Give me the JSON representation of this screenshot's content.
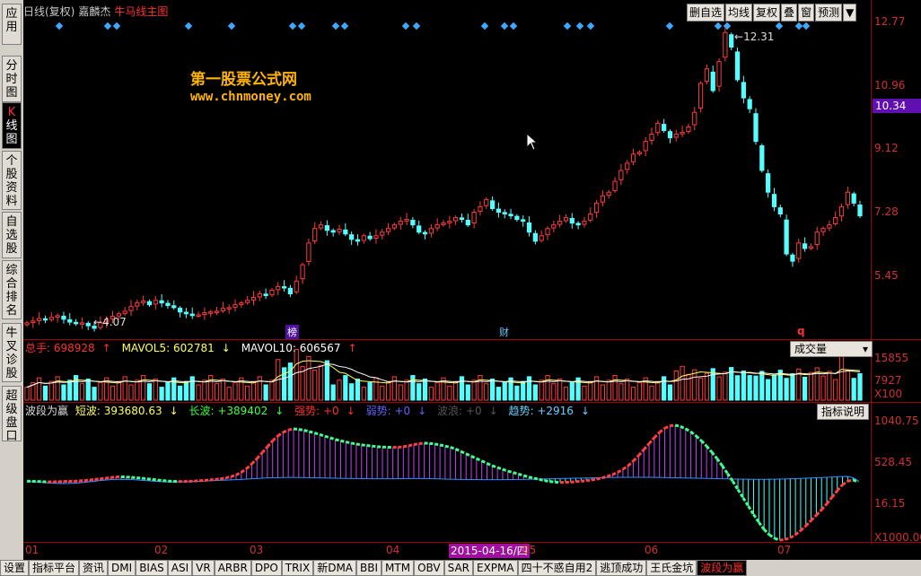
{
  "left_tabs": [
    {
      "label": "应用",
      "top": 4,
      "height": 46
    },
    {
      "label": "分时图",
      "top": 62,
      "height": 52
    },
    {
      "label": "K线图",
      "top": 114,
      "height": 52,
      "active": true
    },
    {
      "label": "个股资料",
      "top": 168,
      "height": 66
    },
    {
      "label": "自选股",
      "top": 236,
      "height": 52
    },
    {
      "label": "综合排名",
      "top": 290,
      "height": 66
    },
    {
      "label": "牛叉诊股",
      "top": 360,
      "height": 66
    },
    {
      "label": "超级盘口",
      "top": 430,
      "height": 62
    }
  ],
  "header": {
    "period": "日线(复权)",
    "stock": "嘉麟杰",
    "template": "牛马线主图"
  },
  "toolbar": [
    "删自选",
    "均线",
    "复权",
    "叠",
    "窗",
    "预测",
    "▼"
  ],
  "watermark": {
    "line1": "第一股票公式网",
    "line2": "www.chnmoney.com"
  },
  "price_axis": {
    "labels": [
      "12.77",
      "10.96",
      "9.12",
      "7.28",
      "5.45"
    ],
    "current": "10.34"
  },
  "annotations": {
    "high": "12.31",
    "low": "4.07",
    "m1": "榜",
    "m2": "财",
    "m3": "q"
  },
  "volume_pane": {
    "total": "总手: 698928",
    "mavol5": "MAVOL5: 602781",
    "mavol10": "MAVOL10: 606567",
    "dropdown": "成交量",
    "axis": [
      "15855",
      "7927",
      "X100"
    ]
  },
  "indicator_pane": {
    "name": "波段为赢",
    "short": "短波: 393680.63",
    "long": "长波: +389402",
    "strong": "强势: +0",
    "weak": "弱势: +0",
    "wave": "波浪: +0",
    "trend": "趋势: +2916",
    "button": "指标说明",
    "axis": [
      "1040.75",
      "528.45",
      "16.15",
      "X1000.00"
    ]
  },
  "dates": {
    "labels": [
      "01",
      "02",
      "03",
      "04",
      "05",
      "06",
      "07"
    ],
    "selected": "2015-04-16/四"
  },
  "bottom_tabs": [
    "设置",
    "指标平台",
    "资讯",
    "DMI",
    "BIAS",
    "ASI",
    "VR",
    "ARBR",
    "DPO",
    "TRIX",
    "新DMA",
    "BBI",
    "MTM",
    "OBV",
    "SAR",
    "EXPMA",
    "四十不惑自用2",
    "逃顶成功",
    "王氏金坑",
    "波段为赢"
  ],
  "colors": {
    "up": "#ff3b3b",
    "down": "#54ffff",
    "axis": "#a00000",
    "diamond": "#3ca8ff"
  },
  "chart_data": {
    "type": "candlestick",
    "title": "嘉麟杰",
    "ylim": [
      4.0,
      12.9
    ],
    "highest": 12.31,
    "lowest": 4.07,
    "closes": [
      4.3,
      4.35,
      4.42,
      4.38,
      4.45,
      4.5,
      4.4,
      4.32,
      4.28,
      4.3,
      4.22,
      4.15,
      4.3,
      4.4,
      4.48,
      4.55,
      4.62,
      4.75,
      4.85,
      4.9,
      4.8,
      4.92,
      4.85,
      4.78,
      4.72,
      4.6,
      4.55,
      4.5,
      4.52,
      4.58,
      4.6,
      4.62,
      4.7,
      4.72,
      4.8,
      4.85,
      4.92,
      5.0,
      5.1,
      5.05,
      5.2,
      5.3,
      5.28,
      5.1,
      5.45,
      5.9,
      6.5,
      6.9,
      7.0,
      6.85,
      6.8,
      6.88,
      6.75,
      6.6,
      6.55,
      6.7,
      6.62,
      6.7,
      6.8,
      6.9,
      7.0,
      7.1,
      7.15,
      7.0,
      6.8,
      6.75,
      6.9,
      7.0,
      7.05,
      7.1,
      7.2,
      7.15,
      7.0,
      7.35,
      7.5,
      7.7,
      7.45,
      7.35,
      7.3,
      7.25,
      7.15,
      7.1,
      6.8,
      6.55,
      6.7,
      6.9,
      7.0,
      7.1,
      7.2,
      7.05,
      7.0,
      7.1,
      7.3,
      7.6,
      7.8,
      7.9,
      8.2,
      8.5,
      8.7,
      8.95,
      9.0,
      9.3,
      9.5,
      9.8,
      9.6,
      9.4,
      9.5,
      9.55,
      9.7,
      10.1,
      10.9,
      11.3,
      10.7,
      11.5,
      12.3,
      11.9,
      11.0,
      10.5,
      10.2,
      9.3,
      8.5,
      7.9,
      7.5,
      7.3,
      6.2,
      6.0,
      6.5,
      6.35,
      6.4,
      6.8,
      6.9,
      7.0,
      7.2,
      7.5,
      7.9,
      7.6,
      7.25
    ],
    "volume": {
      "ylim": [
        0,
        17500
      ],
      "mavol5": 602781,
      "mavol10": 606567,
      "last": 698928
    },
    "indicator": {
      "ylim": [
        -900,
        1150
      ],
      "short": [
        120,
        118,
        115,
        112,
        110,
        110,
        112,
        115,
        118,
        120,
        125,
        130,
        140,
        150,
        160,
        170,
        180,
        190,
        195,
        190,
        185,
        178,
        170,
        160,
        150,
        140,
        130,
        122,
        118,
        115,
        115,
        118,
        122,
        128,
        135,
        142,
        150,
        160,
        175,
        195,
        225,
        270,
        330,
        410,
        500,
        600,
        700,
        800,
        880,
        940,
        980,
        1000,
        990,
        975,
        955,
        930,
        905,
        875,
        850,
        820,
        800,
        780,
        760,
        745,
        730,
        720,
        710,
        700,
        695,
        690,
        688,
        690,
        700,
        715,
        735,
        750,
        760,
        755,
        745,
        730,
        710,
        690,
        660,
        620,
        580,
        540,
        500,
        460,
        420,
        380,
        350,
        320,
        290,
        265,
        240,
        215,
        190,
        170,
        150,
        130,
        115,
        105,
        100,
        100,
        105,
        112,
        120,
        130,
        140,
        155,
        175,
        200,
        230,
        270,
        320,
        380,
        460,
        550,
        650,
        750,
        850,
        940,
        1010,
        1050,
        1060,
        1040,
        1000,
        950,
        880,
        800,
        710,
        610,
        500,
        380,
        250,
        120,
        -20,
        -160,
        -300,
        -440,
        -570,
        -690,
        -780,
        -840,
        -870,
        -860,
        -830,
        -780,
        -710,
        -630,
        -540,
        -450,
        -360,
        -260,
        -150,
        -40,
        60,
        120,
        140,
        110
      ],
      "long": [
        120,
        112,
        105,
        98,
        90,
        85,
        82,
        80,
        82,
        86,
        92,
        100,
        110,
        120,
        130,
        138,
        145,
        150,
        152,
        150,
        147,
        142,
        135,
        128,
        121,
        115,
        110,
        108,
        107,
        108,
        110,
        112,
        115,
        118,
        122,
        126,
        130,
        134,
        138,
        142,
        146,
        150,
        155,
        160,
        165,
        170,
        175,
        178,
        180,
        182,
        183,
        183,
        182,
        181,
        180,
        178,
        176,
        174,
        172,
        170,
        168,
        166,
        165,
        164,
        163,
        162,
        161,
        160,
        160,
        160,
        161,
        162,
        163,
        164,
        165,
        165,
        164,
        162,
        160,
        158,
        156,
        154,
        152,
        150,
        149,
        148,
        147,
        146,
        146,
        146,
        146,
        146,
        147,
        148,
        149,
        150,
        152,
        154,
        156,
        158,
        160,
        162,
        164,
        166,
        168,
        170,
        172,
        174,
        176,
        178,
        180,
        182,
        183,
        184,
        185,
        186,
        186,
        186,
        186,
        185,
        184,
        183,
        182,
        180,
        178,
        176,
        174,
        172,
        170,
        168,
        166,
        164,
        162,
        160,
        158,
        156,
        155,
        154,
        153,
        152,
        152,
        152,
        153,
        154,
        155,
        157,
        160,
        163,
        166,
        170,
        174,
        178,
        182,
        186,
        190,
        194,
        198,
        200,
        180,
        130
      ]
    }
  }
}
